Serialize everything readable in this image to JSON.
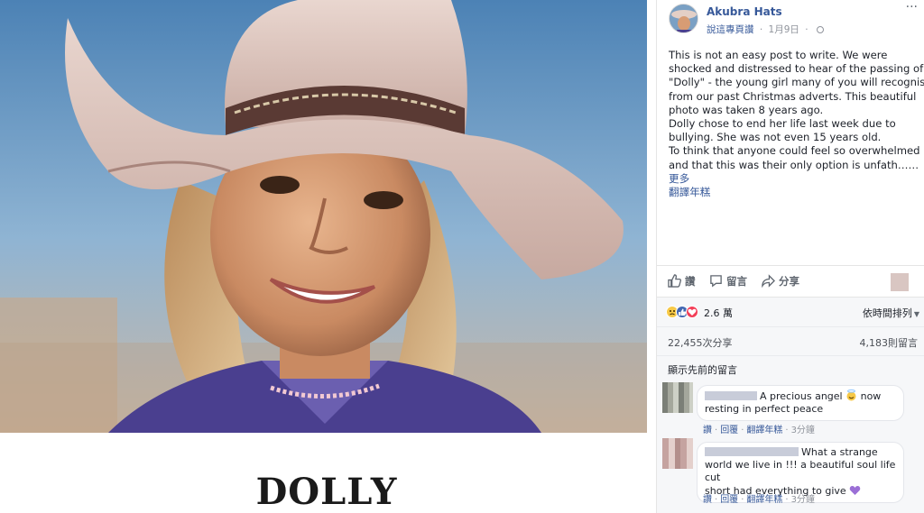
{
  "photo": {
    "caption": "DOLLY"
  },
  "post": {
    "page_name": "Akubra Hats",
    "recommend_label": "說這專頁讚",
    "date": "1月9日",
    "more_label": "···",
    "body_lines": [
      "This is not an easy post to write. We were",
      "shocked and distressed to hear of the passing of",
      "\"Dolly\" - the young girl many of you will recognise",
      "from our past Christmas adverts. This beautiful",
      "photo was taken 8 years ago.",
      "Dolly chose to end her life last week due to",
      "bullying. She was not even 15 years old.",
      "To think that anyone could feel so overwhelmed",
      "and that this was their only option is unfath……"
    ],
    "see_more": "更多",
    "translate": "翻譯年糕"
  },
  "actions": {
    "like": "讚",
    "comment": "留言",
    "share": "分享"
  },
  "reactions": {
    "count": "2.6 萬",
    "sort_label": "依時間排列",
    "sort_caret": "▼",
    "icons": [
      "sad-reaction",
      "like-reaction",
      "love-reaction"
    ]
  },
  "stats": {
    "shares": "22,455次分享",
    "comments": "4,183則留言"
  },
  "previous_comments_label": "顯示先前的留言",
  "comments": [
    {
      "text_line1": "A precious angel",
      "emoji": "smiling-face-with-halo",
      "text_after_emoji": " now",
      "text_line2": "resting in perfect peace",
      "like": "讚",
      "reply": "回覆",
      "translate": "翻譯年糕",
      "time": "3分鐘"
    },
    {
      "text_line1": "What a strange",
      "text_line2": "world we live in !!! a beautiful soul life cut",
      "text_line3": "short had everything to give",
      "emoji": "purple-heart",
      "like": "讚",
      "reply": "回覆",
      "translate": "翻譯年糕",
      "time": "3分鐘"
    }
  ],
  "colors": {
    "link_blue": "#365899",
    "like_blue": "#4267b2",
    "love_red": "#f33e58",
    "sad_yellow": "#f7c948",
    "meta_gray": "#90949c"
  }
}
